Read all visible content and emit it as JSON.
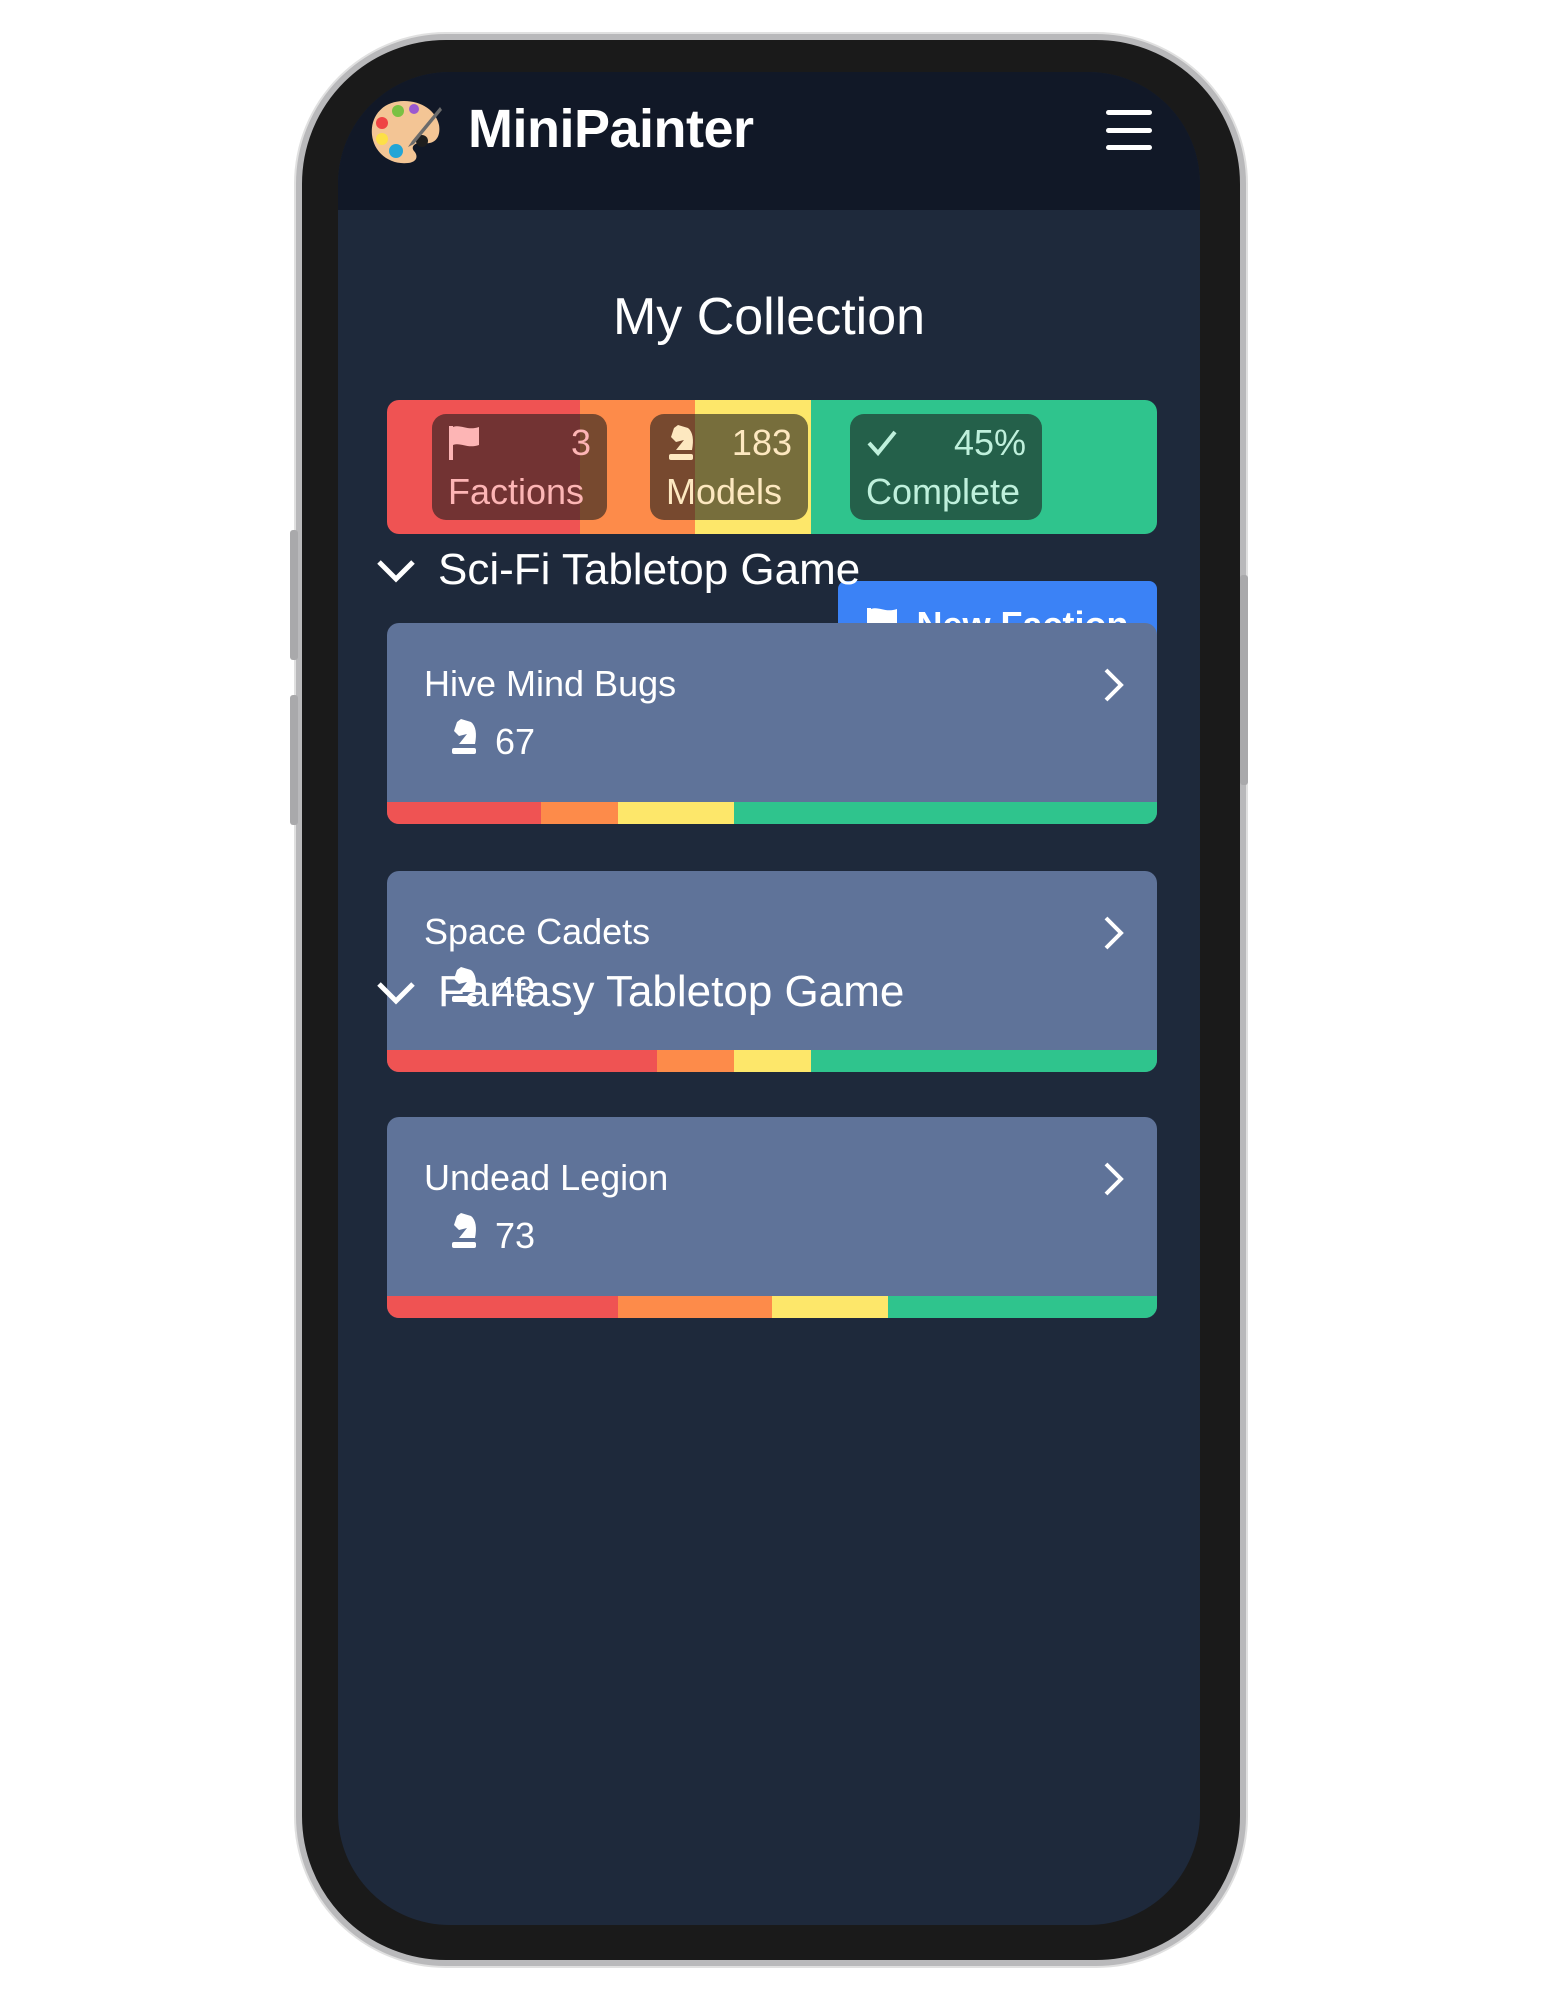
{
  "app": {
    "title": "MiniPainter",
    "logo_icon": "palette-icon",
    "menu_icon": "hamburger-menu-icon"
  },
  "page_title": "My Collection",
  "colors": {
    "red": "#ef5353",
    "orange": "#fd8b4a",
    "yellow": "#fde76a",
    "green": "#2fc48d",
    "button": "#3b82f6",
    "card": "#5f7399"
  },
  "stats": {
    "progress_percent": {
      "red": 25,
      "orange": 15,
      "yellow": 15,
      "green": 45
    },
    "factions": {
      "value": "3",
      "label": "Factions"
    },
    "models": {
      "value": "183",
      "label": "Models"
    },
    "complete": {
      "value": "45%",
      "label": "Complete"
    }
  },
  "new_faction_label": "New Faction",
  "games": [
    {
      "title": "Sci-Fi Tabletop Game",
      "factions": [
        {
          "name": "Hive Mind Bugs",
          "models": "67",
          "progress_percent": {
            "red": 20,
            "orange": 10,
            "yellow": 15,
            "green": 55
          }
        },
        {
          "name": "Space Cadets",
          "models": "43",
          "progress_percent": {
            "red": 35,
            "orange": 10,
            "yellow": 10,
            "green": 45
          }
        }
      ]
    },
    {
      "title": "Fantasy Tabletop Game",
      "factions": [
        {
          "name": "Undead Legion",
          "models": "73",
          "progress_percent": {
            "red": 30,
            "orange": 20,
            "yellow": 15,
            "green": 35
          }
        }
      ]
    }
  ]
}
